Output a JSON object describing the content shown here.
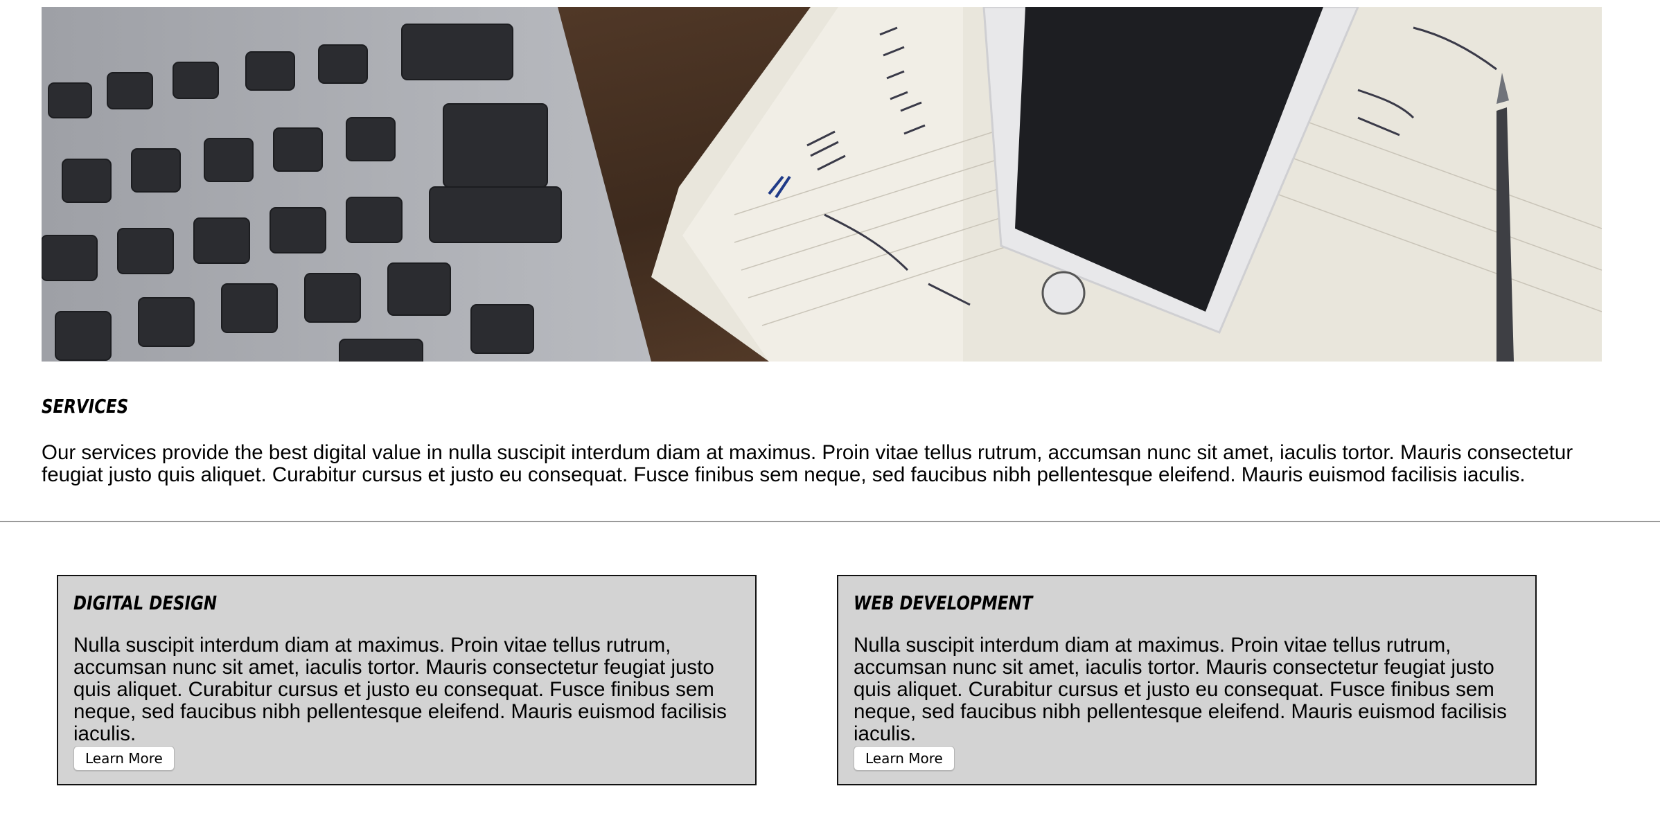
{
  "services": {
    "heading": "SERVICES",
    "description": "Our services provide the best digital value in nulla suscipit interdum diam at maximus. Proin vitae tellus rutrum, accumsan nunc sit amet, iaculis tortor. Mauris consectetur feugiat justo quis aliquet. Curabitur cursus et justo eu consequat. Fusce finibus sem neque, sed faucibus nibh pellentesque eleifend. Mauris euismod facilisis iaculis."
  },
  "cards": [
    {
      "title": "DIGITAL DESIGN",
      "text": "Nulla suscipit interdum diam at maximus. Proin vitae tellus rutrum, accumsan nunc sit amet, iaculis tortor. Mauris consectetur feugiat justo quis aliquet. Curabitur cursus et justo eu consequat. Fusce finibus sem neque, sed faucibus nibh pellentesque eleifend. Mauris euismod facilisis iaculis.",
      "button_label": "Learn More"
    },
    {
      "title": "WEB DEVELOPMENT",
      "text": "Nulla suscipit interdum diam at maximus. Proin vitae tellus rutrum, accumsan nunc sit amet, iaculis tortor. Mauris consectetur feugiat justo quis aliquet. Curabitur cursus et justo eu consequat. Fusce finibus sem neque, sed faucibus nibh pellentesque eleifend. Mauris euismod facilisis iaculis.",
      "button_label": "Learn More"
    }
  ],
  "colors": {
    "card_background": "#d3d3d3",
    "divider": "#9a9a9a"
  }
}
